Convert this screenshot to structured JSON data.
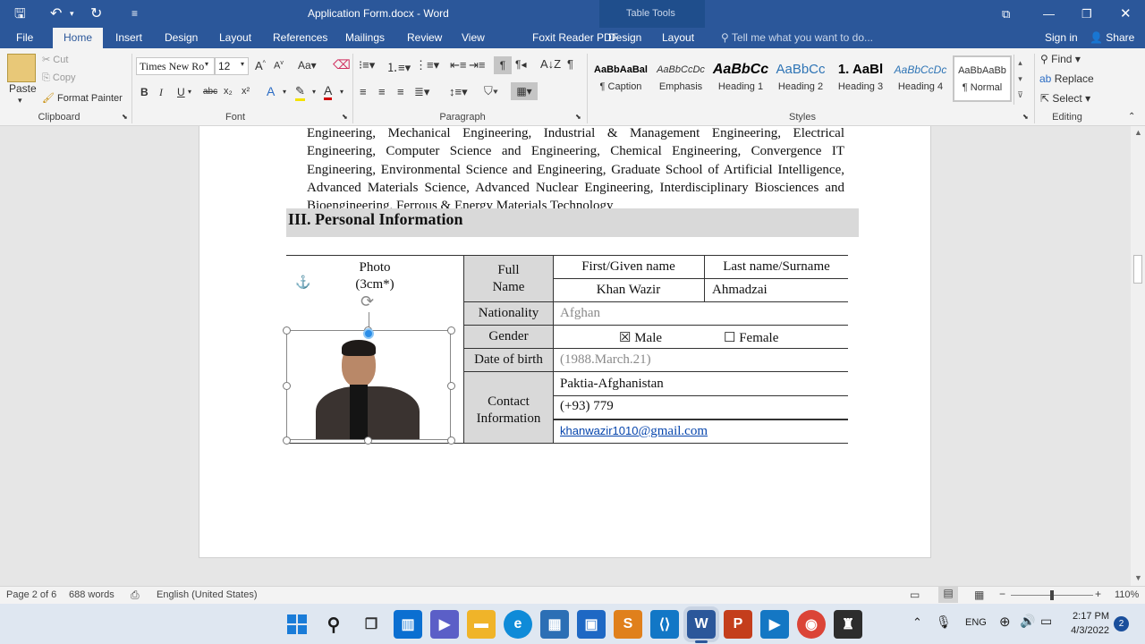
{
  "window": {
    "title": "Application Form.docx - Word",
    "context_tab_group": "Table Tools",
    "sign_in": "Sign in",
    "share": "Share"
  },
  "tabs": [
    {
      "label": "File"
    },
    {
      "label": "Home"
    },
    {
      "label": "Insert"
    },
    {
      "label": "Design"
    },
    {
      "label": "Layout"
    },
    {
      "label": "References"
    },
    {
      "label": "Mailings"
    },
    {
      "label": "Review"
    },
    {
      "label": "View"
    },
    {
      "label": "Foxit Reader PDF"
    },
    {
      "label": "Design"
    },
    {
      "label": "Layout"
    }
  ],
  "tell_me": "Tell me what you want to do...",
  "clipboard": {
    "paste": "Paste",
    "cut": "Cut",
    "copy": "Copy",
    "format_painter": "Format Painter",
    "group": "Clipboard"
  },
  "font": {
    "name": "Times New Ro",
    "size": "12",
    "group": "Font",
    "bold": "B",
    "italic": "I",
    "underline": "U",
    "strike": "abc",
    "sub": "x₂",
    "sup": "x²"
  },
  "paragraph": {
    "group": "Paragraph"
  },
  "styles": {
    "group": "Styles",
    "items": [
      {
        "sample": "AaBbAaBal",
        "name": "¶ Caption"
      },
      {
        "sample": "AaBbCcDc",
        "name": "Emphasis"
      },
      {
        "sample": "AaBbCc",
        "name": "Heading 1"
      },
      {
        "sample": "AaBbCc",
        "name": "Heading 2"
      },
      {
        "sample": "1. AaBl",
        "name": "Heading 3"
      },
      {
        "sample": "AaBbCcDc",
        "name": "Heading 4"
      },
      {
        "sample": "AaBbAaBb",
        "name": "¶ Normal"
      }
    ]
  },
  "editing": {
    "find": "Find",
    "replace": "Replace",
    "select": "Select",
    "group": "Editing"
  },
  "document": {
    "para_lines": [
      "Engineering, Mechanical Engineering, Industrial & Management Engineering, Electrical",
      "Engineering, Computer Science and Engineering, Chemical Engineering, Convergence IT",
      "Engineering, Environmental Science and Engineering, Graduate School of Artificial Intelligence,",
      "Advanced Materials Science, Advanced Nuclear Engineering, Interdisciplinary Biosciences and",
      "Bioengineering, Ferrous & Energy Materials Technology"
    ],
    "section_heading": "III. Personal Information",
    "photo_label_1": "Photo",
    "photo_label_2": "(3cm*)",
    "full_name_1": "Full",
    "full_name_2": "Name",
    "first_name_header": "First/Given name",
    "last_name_header": "Last name/Surname",
    "first_name": "Khan Wazir",
    "last_name": "Ahmadzai",
    "nationality_label": "Nationality",
    "nationality": "Afghan",
    "gender_label": "Gender",
    "male": "☒  Male",
    "female": "☐ Female",
    "dob_label": "Date of birth",
    "dob": "(1988.March.21)",
    "contact_1": "Contact",
    "contact_2": "Information",
    "address": "Paktia-Afghanistan",
    "phone": "(+93) 779",
    "email_user": "khanwazir1010",
    "email_domain": "@gmail.com"
  },
  "status": {
    "page": "Page 2 of 6",
    "words": "688 words",
    "language": "English (United States)",
    "zoom": "110%"
  },
  "clock": {
    "time": "2:17 PM",
    "date": "4/3/2022",
    "notifications": "2",
    "lang": "ENG"
  }
}
